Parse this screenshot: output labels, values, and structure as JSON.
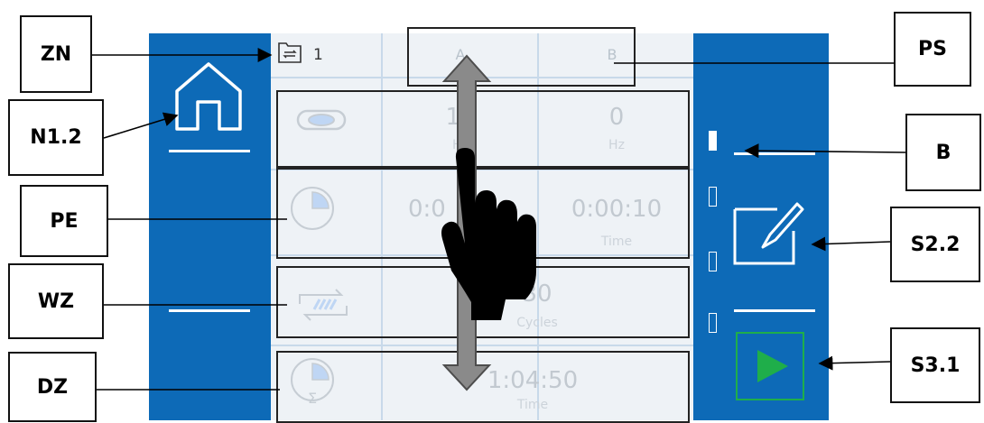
{
  "header": {
    "zone_number": "1",
    "program_columns": [
      "A",
      "B"
    ]
  },
  "rows": {
    "frequency": {
      "value_a": "10",
      "unit_a": "Hz",
      "value_b": "0",
      "unit_b": "Hz"
    },
    "time": {
      "value_a": "0:0",
      "value_b": "0:00:10",
      "unit_b": "Time"
    },
    "cycles": {
      "value": "30",
      "unit": "Cycles"
    },
    "total_time": {
      "value": "1:04:50",
      "unit": "Time"
    }
  },
  "callouts": {
    "zn": "ZN",
    "ps": "PS",
    "n12": "N1.2",
    "b": "B",
    "pe": "PE",
    "s22": "S2.2",
    "wz": "WZ",
    "dz": "DZ",
    "s31": "S3.1"
  },
  "colors": {
    "panel_blue": "#0d6ab7",
    "content_bg": "#eef2f6",
    "play_green": "#1fae4a"
  }
}
